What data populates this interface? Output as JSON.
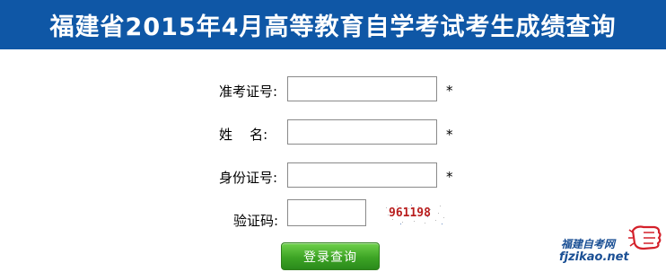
{
  "header": {
    "title": "福建省2015年4月高等教育自学考试考生成绩查询"
  },
  "form": {
    "fields": [
      {
        "label": "准考证号:",
        "value": "",
        "required_mark": "*"
      },
      {
        "label": "姓    名:",
        "value": "",
        "required_mark": "*"
      },
      {
        "label": "身份证号:",
        "value": "",
        "required_mark": "*"
      },
      {
        "label": "验证码:",
        "value": ""
      }
    ],
    "captcha_text": "961198",
    "submit_label": "登录查询"
  },
  "watermark": {
    "site_name": "福建自考网",
    "url": "fjzikao.net"
  },
  "colors": {
    "title_bar": "#0f57a6",
    "button": "#3da425",
    "captcha": "#b81e1e",
    "watermark": "#1a4f94"
  }
}
